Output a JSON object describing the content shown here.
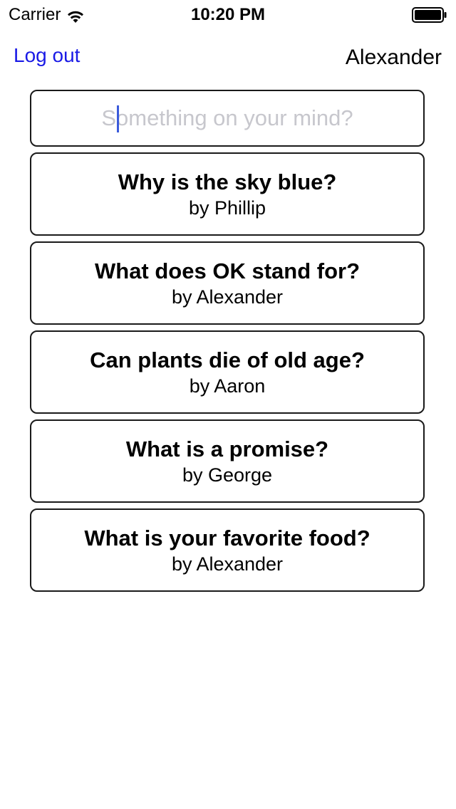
{
  "status_bar": {
    "carrier": "Carrier",
    "time": "10:20 PM",
    "wifi_icon": "wifi-icon",
    "battery_icon": "battery-icon"
  },
  "nav": {
    "logout_label": "Log out",
    "user_name": "Alexander",
    "accent_color": "#1a1ae6"
  },
  "compose": {
    "placeholder": "Something on your mind?",
    "value": ""
  },
  "questions": [
    {
      "title": "Why is the sky blue?",
      "author": "by Phillip"
    },
    {
      "title": "What does OK stand for?",
      "author": "by Alexander"
    },
    {
      "title": "Can plants die of old age?",
      "author": "by Aaron"
    },
    {
      "title": "What is a promise?",
      "author": "by George"
    },
    {
      "title": "What is your favorite food?",
      "author": "by Alexander"
    }
  ]
}
